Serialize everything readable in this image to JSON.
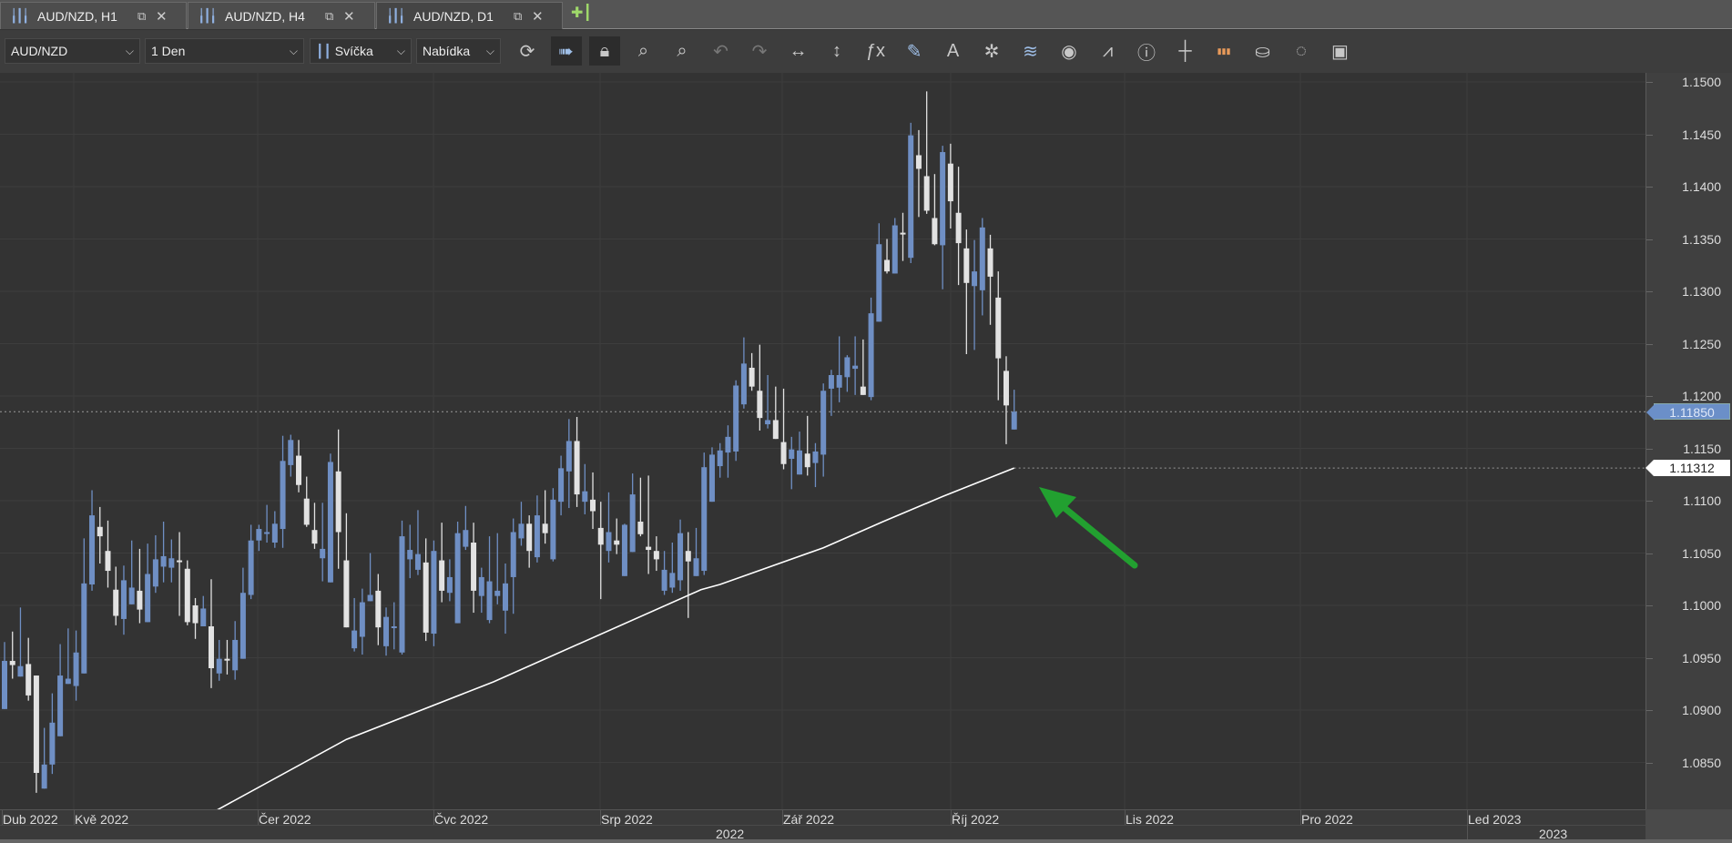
{
  "tabs": [
    {
      "label": "AUD/NZD, H1",
      "active": false
    },
    {
      "label": "AUD/NZD, H4",
      "active": false
    },
    {
      "label": "AUD/NZD, D1",
      "active": true
    }
  ],
  "toolbar": {
    "symbol": "AUD/NZD",
    "timeframe": "1 Den",
    "chart_type": "Svíčka",
    "price_type": "Nabídka",
    "icons": [
      "refresh-icon",
      "auto-scroll-icon",
      "lock-icon",
      "zoom-in-icon",
      "zoom-out-icon",
      "undo-icon",
      "redo-icon",
      "horizontal-resize-icon",
      "vertical-resize-icon",
      "indicators-fx-icon",
      "pencil-icon",
      "text-icon",
      "objects-icon",
      "layers-icon",
      "eye-icon",
      "alert-chart-icon",
      "info-icon",
      "crosshair-icon",
      "color-bars-icon",
      "paint-bucket-icon",
      "aperture-icon",
      "save-icon"
    ]
  },
  "chart_data": {
    "type": "candlestick",
    "symbol": "AUD/NZD",
    "timeframe": "D1",
    "colors": {
      "up": "#6f8fc4",
      "down": "#e2e2e2",
      "ma": "#ffffff",
      "arrow": "#22a030",
      "background": "#333333"
    },
    "ylim": [
      1.0804,
      1.1509
    ],
    "yticks": [
      "1.1500",
      "1.1450",
      "1.1400",
      "1.1350",
      "1.1300",
      "1.1250",
      "1.1200",
      "1.1150",
      "1.1100",
      "1.1050",
      "1.1000",
      "1.0950",
      "1.0900",
      "1.0850"
    ],
    "month_labels": [
      "Dub 2022",
      "Kvě 2022",
      "Čer 2022",
      "Čvc 2022",
      "Srp 2022",
      "Zář 2022",
      "Říj 2022",
      "Lis 2022",
      "Pro 2022",
      "Led 2023"
    ],
    "year_labels": [
      "2022",
      "2023"
    ],
    "last_price": "1.11850",
    "ma_value": "1.11312",
    "ohlc": [
      [
        1.0901,
        1.0965,
        1.0901,
        1.0947
      ],
      [
        1.0947,
        1.0975,
        1.093,
        1.0943
      ],
      [
        1.0932,
        1.0998,
        1.0932,
        1.0942
      ],
      [
        1.0944,
        1.0969,
        1.0909,
        1.0914
      ],
      [
        1.0933,
        1.0933,
        1.0821,
        1.084
      ],
      [
        1.0825,
        1.0883,
        1.0825,
        1.0848
      ],
      [
        1.0848,
        1.0916,
        1.0839,
        1.0888
      ],
      [
        1.0875,
        1.0963,
        1.0875,
        1.0933
      ],
      [
        1.0925,
        1.0978,
        1.0925,
        1.093
      ],
      [
        1.0923,
        1.0976,
        1.0909,
        1.0955
      ],
      [
        1.0935,
        1.1064,
        1.0935,
        1.1021
      ],
      [
        1.102,
        1.111,
        1.1014,
        1.1086
      ],
      [
        1.1075,
        1.1094,
        1.104,
        1.1066
      ],
      [
        1.1052,
        1.1081,
        1.1017,
        1.1033
      ],
      [
        1.1015,
        1.1037,
        1.0981,
        1.099
      ],
      [
        1.0987,
        1.1038,
        1.0972,
        1.1024
      ],
      [
        1.1001,
        1.1062,
        1.1001,
        1.1017
      ],
      [
        1.1014,
        1.1054,
        1.0983,
        1.0996
      ],
      [
        1.0984,
        1.1059,
        1.0984,
        1.103
      ],
      [
        1.1018,
        1.1067,
        1.1012,
        1.1044
      ],
      [
        1.1037,
        1.108,
        1.1022,
        1.1047
      ],
      [
        1.1036,
        1.1063,
        1.1022,
        1.1045
      ],
      [
        1.1043,
        1.107,
        1.099,
        1.1042
      ],
      [
        1.1035,
        1.1043,
        1.0981,
        1.0984
      ],
      [
        1.1,
        1.1007,
        1.0968,
        1.0983
      ],
      [
        1.098,
        1.1009,
        1.098,
        1.0997
      ],
      [
        1.098,
        1.1025,
        1.0921,
        1.094
      ],
      [
        1.0935,
        1.0967,
        1.0928,
        1.0949
      ],
      [
        1.0949,
        1.0967,
        1.0934,
        1.0948
      ],
      [
        1.0938,
        1.0985,
        1.0929,
        1.0967
      ],
      [
        1.0949,
        1.1036,
        1.0949,
        1.1012
      ],
      [
        1.101,
        1.1077,
        1.1006,
        1.1062
      ],
      [
        1.1062,
        1.1077,
        1.1052,
        1.1073
      ],
      [
        1.1069,
        1.1096,
        1.106,
        1.107
      ],
      [
        1.106,
        1.109,
        1.1055,
        1.1078
      ],
      [
        1.1073,
        1.1162,
        1.1055,
        1.1138
      ],
      [
        1.1134,
        1.1163,
        1.1123,
        1.1158
      ],
      [
        1.1143,
        1.1158,
        1.1108,
        1.1115
      ],
      [
        1.1102,
        1.1123,
        1.1075,
        1.1077
      ],
      [
        1.1072,
        1.1098,
        1.1054,
        1.1059
      ],
      [
        1.1045,
        1.1098,
        1.1023,
        1.1054
      ],
      [
        1.1022,
        1.1145,
        1.1022,
        1.1137
      ],
      [
        1.1128,
        1.1168,
        1.1035,
        1.107
      ],
      [
        1.1043,
        1.1088,
        1.0979,
        1.0979
      ],
      [
        1.0959,
        1.1007,
        1.0956,
        1.0976
      ],
      [
        1.097,
        1.1016,
        1.0953,
        1.1003
      ],
      [
        1.1004,
        1.105,
        1.1004,
        1.101
      ],
      [
        1.1014,
        1.103,
        1.0962,
        1.0979
      ],
      [
        1.0961,
        1.0998,
        1.0952,
        1.0989
      ],
      [
        1.0979,
        1.1003,
        1.0958,
        1.098
      ],
      [
        1.0955,
        1.1081,
        1.0953,
        1.1066
      ],
      [
        1.1044,
        1.1077,
        1.1026,
        1.1053
      ],
      [
        1.1034,
        1.1091,
        1.1029,
        1.1049
      ],
      [
        1.1041,
        1.1064,
        1.0966,
        1.0974
      ],
      [
        1.0973,
        1.1062,
        1.0961,
        1.1052
      ],
      [
        1.1043,
        1.1079,
        1.1003,
        1.1014
      ],
      [
        1.1012,
        1.1044,
        1.1004,
        1.1027
      ],
      [
        1.0983,
        1.108,
        1.0983,
        1.1069
      ],
      [
        1.1056,
        1.1095,
        1.1053,
        1.1072
      ],
      [
        1.106,
        1.1079,
        1.0993,
        1.1014
      ],
      [
        1.1009,
        1.1036,
        1.0993,
        1.1027
      ],
      [
        1.0986,
        1.1066,
        1.0983,
        1.1023
      ],
      [
        1.1009,
        1.1069,
        1.1001,
        1.1014
      ],
      [
        1.0995,
        1.104,
        1.0973,
        1.1021
      ],
      [
        1.1027,
        1.1083,
        1.0992,
        1.107
      ],
      [
        1.1064,
        1.1099,
        1.1057,
        1.1078
      ],
      [
        1.1078,
        1.1086,
        1.1036,
        1.1052
      ],
      [
        1.1046,
        1.1105,
        1.1041,
        1.1086
      ],
      [
        1.1078,
        1.111,
        1.1059,
        1.1069
      ],
      [
        1.1044,
        1.1112,
        1.1042,
        1.1101
      ],
      [
        1.1099,
        1.1143,
        1.1086,
        1.1131
      ],
      [
        1.1128,
        1.1178,
        1.1093,
        1.1157
      ],
      [
        1.1157,
        1.118,
        1.1094,
        1.1106
      ],
      [
        1.1099,
        1.1135,
        1.1087,
        1.1109
      ],
      [
        1.1101,
        1.1127,
        1.1073,
        1.109
      ],
      [
        1.1074,
        1.1099,
        1.1006,
        1.1058
      ],
      [
        1.1052,
        1.1108,
        1.1041,
        1.107
      ],
      [
        1.1062,
        1.1083,
        1.1049,
        1.1058
      ],
      [
        1.1028,
        1.1078,
        1.1028,
        1.1077
      ],
      [
        1.1051,
        1.1126,
        1.1051,
        1.1106
      ],
      [
        1.108,
        1.1122,
        1.1066,
        1.1068
      ],
      [
        1.1056,
        1.1124,
        1.103,
        1.1053
      ],
      [
        1.1052,
        1.1066,
        1.1033,
        1.1044
      ],
      [
        1.1014,
        1.1052,
        1.101,
        1.1034
      ],
      [
        1.1017,
        1.106,
        1.1012,
        1.1031
      ],
      [
        1.1024,
        1.1082,
        1.1014,
        1.1069
      ],
      [
        1.1052,
        1.107,
        1.0988,
        1.1042
      ],
      [
        1.1028,
        1.1074,
        1.1028,
        1.1045
      ],
      [
        1.1033,
        1.1146,
        1.1029,
        1.1132
      ],
      [
        1.1099,
        1.1151,
        1.1099,
        1.1144
      ],
      [
        1.1133,
        1.1155,
        1.1122,
        1.1148
      ],
      [
        1.1146,
        1.1172,
        1.1122,
        1.1161
      ],
      [
        1.1147,
        1.1215,
        1.1138,
        1.121
      ],
      [
        1.1192,
        1.1256,
        1.1188,
        1.1231
      ],
      [
        1.1227,
        1.1241,
        1.1205,
        1.1209
      ],
      [
        1.1205,
        1.1249,
        1.1167,
        1.1179
      ],
      [
        1.1173,
        1.122,
        1.1169,
        1.1177
      ],
      [
        1.1177,
        1.1209,
        1.1159,
        1.1159
      ],
      [
        1.1156,
        1.1207,
        1.113,
        1.1135
      ],
      [
        1.114,
        1.1161,
        1.1111,
        1.1149
      ],
      [
        1.1125,
        1.1166,
        1.1125,
        1.1148
      ],
      [
        1.1145,
        1.1181,
        1.1124,
        1.1132
      ],
      [
        1.1136,
        1.1155,
        1.1113,
        1.1147
      ],
      [
        1.1144,
        1.1212,
        1.1123,
        1.1205
      ],
      [
        1.1207,
        1.1225,
        1.1181,
        1.122
      ],
      [
        1.1208,
        1.1257,
        1.1194,
        1.122
      ],
      [
        1.1218,
        1.1239,
        1.1204,
        1.1237
      ],
      [
        1.1226,
        1.1257,
        1.1201,
        1.1229
      ],
      [
        1.1209,
        1.1254,
        1.1201,
        1.1201
      ],
      [
        1.1199,
        1.1294,
        1.1196,
        1.1279
      ],
      [
        1.1271,
        1.1365,
        1.1271,
        1.1345
      ],
      [
        1.133,
        1.135,
        1.1317,
        1.1319
      ],
      [
        1.1317,
        1.137,
        1.1317,
        1.1363
      ],
      [
        1.1356,
        1.1375,
        1.1329,
        1.1355
      ],
      [
        1.1332,
        1.1461,
        1.1327,
        1.1449
      ],
      [
        1.143,
        1.1454,
        1.1371,
        1.1417
      ],
      [
        1.141,
        1.1491,
        1.1374,
        1.1377
      ],
      [
        1.137,
        1.1412,
        1.1344,
        1.1345
      ],
      [
        1.1344,
        1.1439,
        1.1302,
        1.1433
      ],
      [
        1.1422,
        1.1441,
        1.136,
        1.1386
      ],
      [
        1.1375,
        1.1419,
        1.1306,
        1.1346
      ],
      [
        1.1341,
        1.1359,
        1.124,
        1.1308
      ],
      [
        1.1305,
        1.1349,
        1.1244,
        1.1319
      ],
      [
        1.1301,
        1.137,
        1.1277,
        1.1361
      ],
      [
        1.1341,
        1.1354,
        1.1268,
        1.1314
      ],
      [
        1.1294,
        1.1319,
        1.1196,
        1.1236
      ],
      [
        1.1224,
        1.1238,
        1.1154,
        1.1191
      ],
      [
        1.1168,
        1.1206,
        1.1168,
        1.1185
      ]
    ],
    "moving_average": [
      [
        26.6,
        1.0804
      ],
      [
        43,
        1.0872
      ],
      [
        61.5,
        1.0927
      ],
      [
        87.6,
        1.1015
      ],
      [
        90,
        1.102
      ],
      [
        103,
        1.1055
      ],
      [
        110.5,
        1.108
      ],
      [
        118,
        1.1104
      ],
      [
        127,
        1.11312
      ]
    ]
  }
}
